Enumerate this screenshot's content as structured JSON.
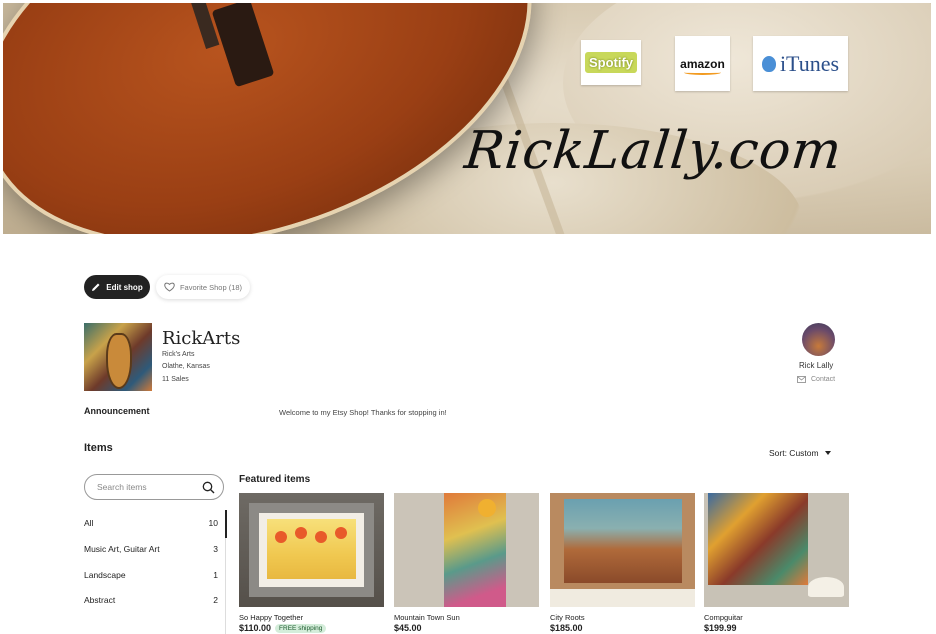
{
  "banner": {
    "title": "RickLally.com",
    "logos": [
      "Spotify",
      "amazon",
      "iTunes"
    ]
  },
  "actions": {
    "edit_label": "Edit shop",
    "favorite_label": "Favorite Shop (18)"
  },
  "shop": {
    "name": "RickArts",
    "tagline": "Rick's Arts",
    "location": "Olathe, Kansas",
    "sales": "11 Sales"
  },
  "owner": {
    "name": "Rick Lally",
    "contact_label": "Contact"
  },
  "announcement": {
    "label": "Announcement",
    "text": "Welcome to my Etsy Shop! Thanks for stopping in!"
  },
  "items": {
    "heading": "Items",
    "sort_label": "Sort: Custom",
    "search_placeholder": "Search items",
    "categories": [
      {
        "label": "All",
        "count": "10"
      },
      {
        "label": "Music Art, Guitar Art",
        "count": "3"
      },
      {
        "label": "Landscape",
        "count": "1"
      },
      {
        "label": "Abstract",
        "count": "2"
      }
    ]
  },
  "featured": {
    "heading": "Featured items",
    "cards": [
      {
        "title": "So Happy Together",
        "price": "$110.00",
        "badge": "FREE shipping"
      },
      {
        "title": "Mountain Town Sun",
        "price": "$45.00"
      },
      {
        "title": "City Roots",
        "price": "$185.00"
      },
      {
        "title": "Compguitar",
        "price": "$199.99"
      }
    ]
  },
  "colors": {
    "primary_button": "#222222",
    "badge_bg": "#d4edda"
  }
}
